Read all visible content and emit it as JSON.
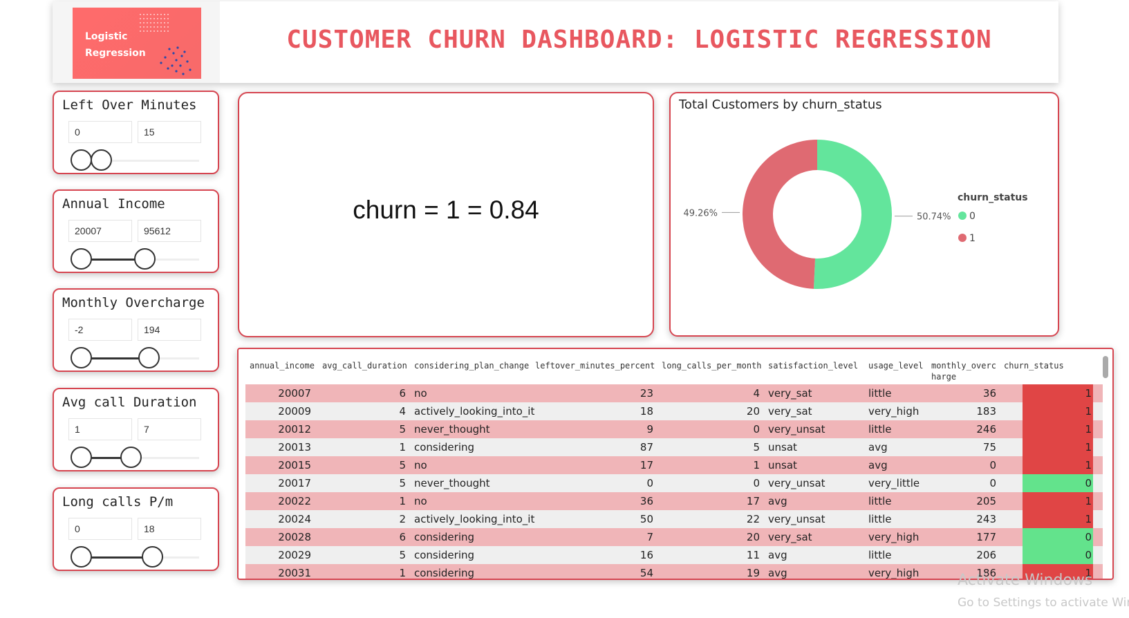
{
  "header": {
    "title": "CUSTOMER CHURN DASHBOARD: LOGISTIC REGRESSION",
    "logo_line1": "Logistic",
    "logo_line2": "Regression"
  },
  "slicers": [
    {
      "title": "Left Over Minutes",
      "min": "0",
      "max": "15",
      "range_min": 0,
      "range_max": 15
    },
    {
      "title": "Annual Income",
      "min": "20007",
      "max": "95612",
      "range_min": 20007,
      "range_max": 95612
    },
    {
      "title": "Monthly Overcharge",
      "min": "-2",
      "max": "194",
      "range_min": -2,
      "range_max": 194
    },
    {
      "title": "Avg call Duration",
      "min": "1",
      "max": "7",
      "range_min": 1,
      "range_max": 7
    },
    {
      "title": "Long calls P/m",
      "min": "0",
      "max": "18",
      "range_min": 0,
      "range_max": 18
    }
  ],
  "card": {
    "value": "churn = 1 = 0.84"
  },
  "donut": {
    "title": "Total Customers by churn_status",
    "legend_title": "churn_status",
    "slices": [
      {
        "label": "0",
        "percent": 50.74,
        "percent_label": "50.74%",
        "color": "#63e59c"
      },
      {
        "label": "1",
        "percent": 49.26,
        "percent_label": "49.26%",
        "color": "#df6a72"
      }
    ]
  },
  "table": {
    "columns": [
      "annual_income",
      "avg_call_duration",
      "considering_plan_change",
      "leftover_minutes_percent",
      "long_calls_per_month",
      "satisfaction_level",
      "usage_level",
      "monthly_overc",
      "churn_status"
    ],
    "column_header_line2": "harge",
    "rows": [
      [
        "20007",
        "6",
        "no",
        "23",
        "4",
        "very_sat",
        "little",
        "36",
        "1"
      ],
      [
        "20009",
        "4",
        "actively_looking_into_it",
        "18",
        "20",
        "very_sat",
        "very_high",
        "183",
        "1"
      ],
      [
        "20012",
        "5",
        "never_thought",
        "9",
        "0",
        "very_unsat",
        "little",
        "246",
        "1"
      ],
      [
        "20013",
        "1",
        "considering",
        "87",
        "5",
        "unsat",
        "avg",
        "75",
        "1"
      ],
      [
        "20015",
        "5",
        "no",
        "17",
        "1",
        "unsat",
        "avg",
        "0",
        "1"
      ],
      [
        "20017",
        "5",
        "never_thought",
        "0",
        "0",
        "very_unsat",
        "very_little",
        "0",
        "0"
      ],
      [
        "20022",
        "1",
        "no",
        "36",
        "17",
        "avg",
        "little",
        "205",
        "1"
      ],
      [
        "20024",
        "2",
        "actively_looking_into_it",
        "50",
        "22",
        "very_unsat",
        "little",
        "243",
        "1"
      ],
      [
        "20028",
        "6",
        "considering",
        "7",
        "20",
        "very_sat",
        "very_high",
        "177",
        "0"
      ],
      [
        "20029",
        "5",
        "considering",
        "16",
        "11",
        "avg",
        "little",
        "206",
        "0"
      ],
      [
        "20031",
        "1",
        "considering",
        "54",
        "19",
        "avg",
        "very_high",
        "186",
        "1"
      ]
    ],
    "churn_colors": {
      "1": "#e04545",
      "0": "#63e38c"
    }
  },
  "watermark": {
    "line1": "Activate Windows",
    "line2": "Go to Settings to activate Wind"
  }
}
